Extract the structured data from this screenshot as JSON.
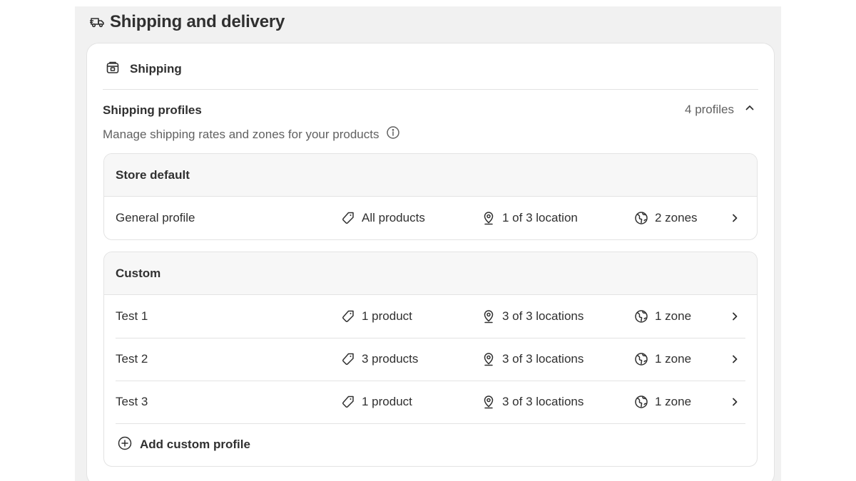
{
  "page": {
    "title": "Shipping and delivery",
    "title_icon": "truck-icon"
  },
  "card": {
    "title": "Shipping",
    "title_icon": "package-icon"
  },
  "shipping_profiles": {
    "title": "Shipping profiles",
    "description": "Manage shipping rates and zones for your products",
    "count": "4 profiles",
    "expanded": true
  },
  "store_default": {
    "header": "Store default",
    "rows": [
      {
        "name": "General profile",
        "products": "All products",
        "locations": "1 of 3 location",
        "zones": "2 zones"
      }
    ]
  },
  "custom": {
    "header": "Custom",
    "rows": [
      {
        "name": "Test 1",
        "products": "1 product",
        "locations": "3 of 3 locations",
        "zones": "1 zone"
      },
      {
        "name": "Test 2",
        "products": "3 products",
        "locations": "3 of 3 locations",
        "zones": "1 zone"
      },
      {
        "name": "Test 3",
        "products": "1 product",
        "locations": "3 of 3 locations",
        "zones": "1 zone"
      }
    ],
    "add_label": "Add custom profile"
  },
  "colors": {
    "page_background": "#f1f1f1",
    "card_background": "#ffffff",
    "text_primary": "#303030",
    "text_secondary": "#616161",
    "border": "#e3e3e3"
  }
}
